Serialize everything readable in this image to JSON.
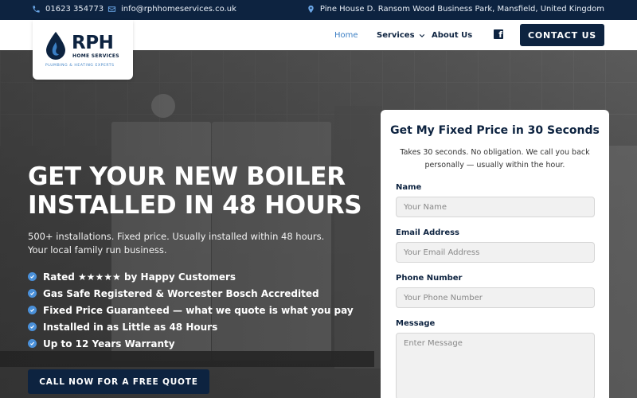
{
  "topbar": {
    "phone": "01623 354773",
    "email": "info@rphhomeservices.co.uk",
    "address": "Pine House D. Ransom Wood Business Park, Mansfield, United Kingdom"
  },
  "logo": {
    "brand": "RPH",
    "line1": "HOME SERVICES",
    "line2": "PLUMBING & HEATING EXPERTS"
  },
  "nav": {
    "home": "Home",
    "services": "Services",
    "about": "About Us",
    "contact_button": "CONTACT US"
  },
  "hero": {
    "headline_line1": "GET YOUR NEW BOILER",
    "headline_line2": "INSTALLED IN 48 HOURS",
    "subtext": "500+ installations. Fixed price. Usually installed within 48 hours. Your local family run business.",
    "bullets": [
      "Rated ★★★★★ by Happy Customers",
      "Gas Safe Registered & Worcester Bosch Accredited",
      "Fixed Price Guaranteed — what we quote is what you pay",
      "Installed in as Little as 48 Hours",
      "Up to 12 Years Warranty"
    ],
    "cta": "CALL NOW FOR A FREE QUOTE"
  },
  "form": {
    "title": "Get My Fixed Price in 30 Seconds",
    "description": "Takes 30 seconds. No obligation. We call you back personally — usually within the hour.",
    "name_label": "Name",
    "name_placeholder": "Your Name",
    "email_label": "Email Address",
    "email_placeholder": "Your Email Address",
    "phone_label": "Phone Number",
    "phone_placeholder": "Your Phone Number",
    "message_label": "Message",
    "message_placeholder": "Enter Message"
  },
  "colors": {
    "navy": "#0d2340",
    "accent_blue": "#3b7fc4",
    "check_blue": "#4a90d9"
  }
}
